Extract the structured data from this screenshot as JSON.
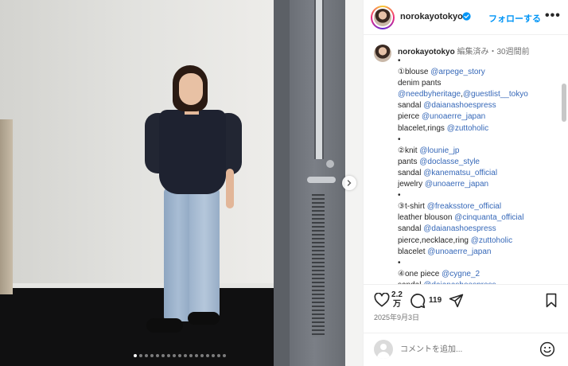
{
  "post": {
    "username": "norokayotokyo",
    "follow_label": "フォローする",
    "more_label": "•••",
    "carousel": {
      "dot_count": 17,
      "active_index": 0
    }
  },
  "caption": {
    "username": "norokayotokyo",
    "meta": "編集済み・30週間前",
    "lines": [
      [
        {
          "t": "•"
        }
      ],
      [
        {
          "t": "①blouse "
        },
        {
          "t": "@arpege_story",
          "m": true
        }
      ],
      [
        {
          "t": "denim pants"
        }
      ],
      [
        {
          "t": "@needbyheritage",
          "m": true
        },
        {
          "t": ","
        },
        {
          "t": "@guestlist__tokyo",
          "m": true
        }
      ],
      [
        {
          "t": "sandal "
        },
        {
          "t": "@daianashoespress",
          "m": true
        }
      ],
      [
        {
          "t": "pierce "
        },
        {
          "t": "@unoaerre_japan",
          "m": true
        }
      ],
      [
        {
          "t": "blacelet,rings "
        },
        {
          "t": "@zuttoholic",
          "m": true
        }
      ],
      [
        {
          "t": "•"
        }
      ],
      [
        {
          "t": "②knit "
        },
        {
          "t": "@lounie_jp",
          "m": true
        }
      ],
      [
        {
          "t": "pants "
        },
        {
          "t": "@doclasse_style",
          "m": true
        }
      ],
      [
        {
          "t": "sandal "
        },
        {
          "t": "@kanematsu_official",
          "m": true
        }
      ],
      [
        {
          "t": "jewelry "
        },
        {
          "t": "@unoaerre_japan",
          "m": true
        }
      ],
      [
        {
          "t": "•"
        }
      ],
      [
        {
          "t": "③t-shirt "
        },
        {
          "t": "@freaksstore_official",
          "m": true
        }
      ],
      [
        {
          "t": "leather blouson  "
        },
        {
          "t": "@cinquanta_official",
          "m": true
        }
      ],
      [
        {
          "t": "sandal "
        },
        {
          "t": "@daianashoespress",
          "m": true
        }
      ],
      [
        {
          "t": "pierce,necklace,ring "
        },
        {
          "t": "@zuttoholic",
          "m": true
        }
      ],
      [
        {
          "t": "blacelet "
        },
        {
          "t": "@unoaerre_japan",
          "m": true
        }
      ],
      [
        {
          "t": "•"
        }
      ],
      [
        {
          "t": "④one piece "
        },
        {
          "t": "@cygne_2",
          "m": true
        }
      ],
      [
        {
          "t": "sandal "
        },
        {
          "t": "@daianashoespress",
          "m": true
        }
      ]
    ]
  },
  "actions": {
    "like_count_line1": "2.2",
    "like_count_line2": "万",
    "comment_count": "119",
    "date": "2025年9月3日"
  },
  "comment_box": {
    "placeholder": "コメントを追加..."
  },
  "icons": {
    "heart": "heart-icon",
    "comment": "comment-icon",
    "share": "share-icon",
    "save": "bookmark-icon",
    "emoji": "emoji-icon",
    "verified": "verified-badge-icon",
    "next": "chevron-right-icon"
  },
  "colors": {
    "link": "#0095f6",
    "mention": "#3668b8",
    "text": "#262626",
    "muted": "#737373"
  }
}
